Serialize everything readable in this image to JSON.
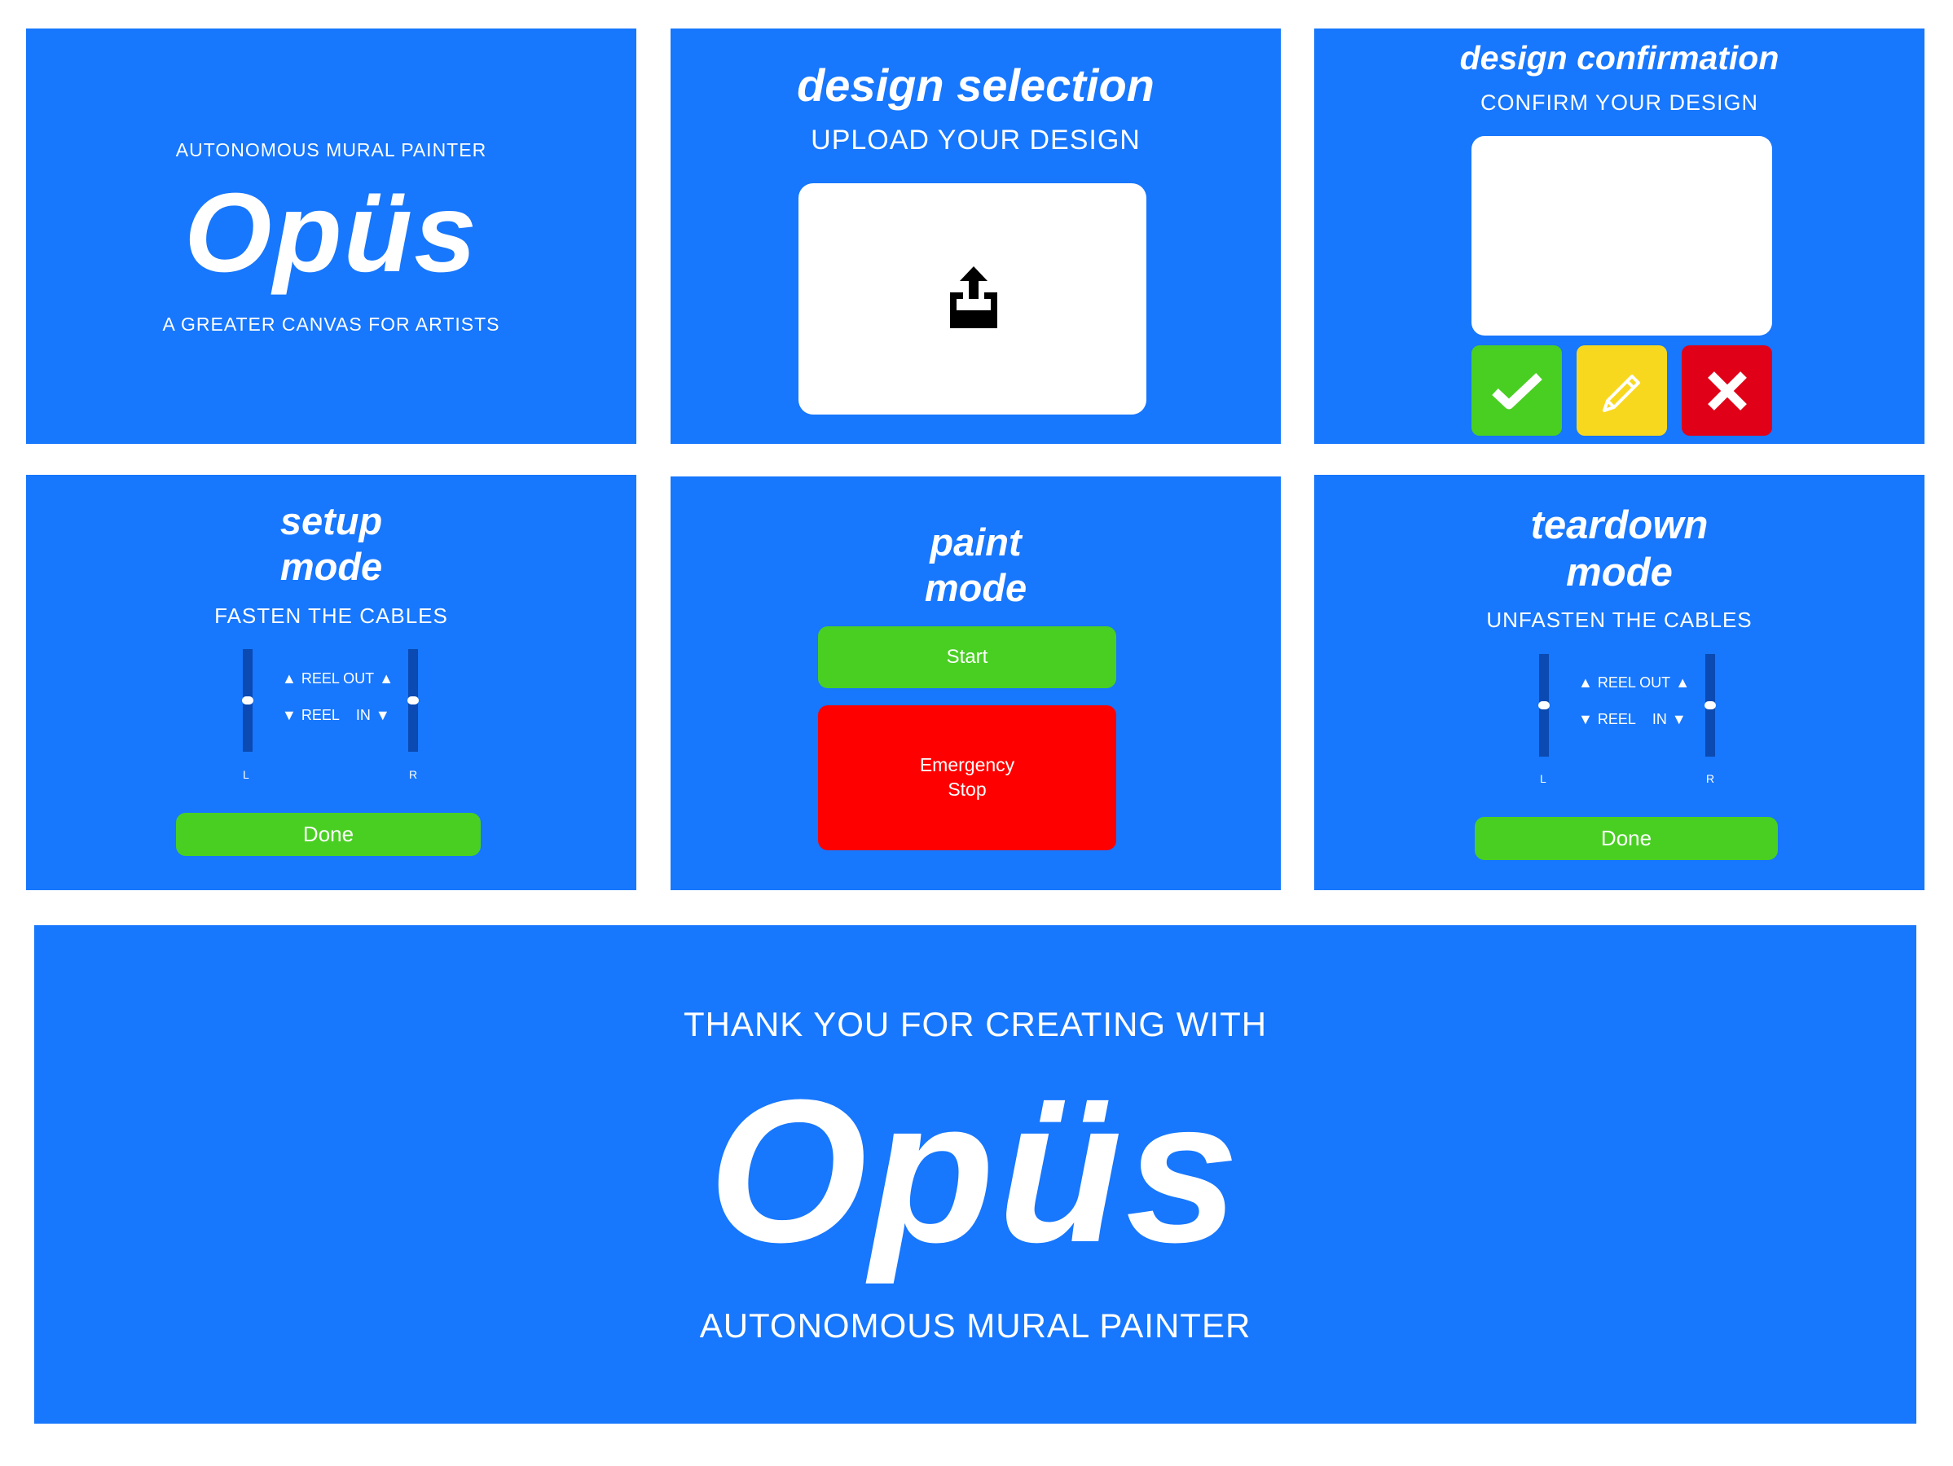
{
  "colors": {
    "panel_blue": "#1777fd",
    "button_green": "#49cf22",
    "stop_red": "#ff0000",
    "confirm_yellow": "#f8d81e",
    "reject_red": "#e00018",
    "slider_track": "#0a4ab2"
  },
  "splash": {
    "tagline_top": "AUTONOMOUS MURAL PAINTER",
    "logo": "Opüs",
    "tagline_bottom": "A GREATER CANVAS FOR ARTISTS"
  },
  "design_selection": {
    "title": "design selection",
    "subtitle": "UPLOAD YOUR DESIGN",
    "upload_icon": "upload-tray-icon"
  },
  "design_confirmation": {
    "title": "design confirmation",
    "subtitle": "CONFIRM YOUR DESIGN",
    "buttons": [
      "check-icon",
      "pencil-icon",
      "close-x-icon"
    ]
  },
  "setup_mode": {
    "title_line1": "setup",
    "title_line2": "mode",
    "subtitle": "FASTEN THE CABLES",
    "reel_out": "REEL OUT",
    "reel_in_a": "REEL",
    "reel_in_b": "IN",
    "left_label": "L",
    "right_label": "R",
    "done": "Done"
  },
  "paint_mode": {
    "title_line1": "paint",
    "title_line2": "mode",
    "start": "Start",
    "stop_line1": "Emergency",
    "stop_line2": "Stop"
  },
  "teardown_mode": {
    "title_line1": "teardown",
    "title_line2": "mode",
    "subtitle": "UNFASTEN THE CABLES",
    "reel_out": "REEL OUT",
    "reel_in_a": "REEL",
    "reel_in_b": "IN",
    "left_label": "L",
    "right_label": "R",
    "done": "Done"
  },
  "thank_you": {
    "line1": "THANK YOU FOR CREATING WITH",
    "logo": "Opüs",
    "line2": "AUTONOMOUS MURAL PAINTER"
  }
}
